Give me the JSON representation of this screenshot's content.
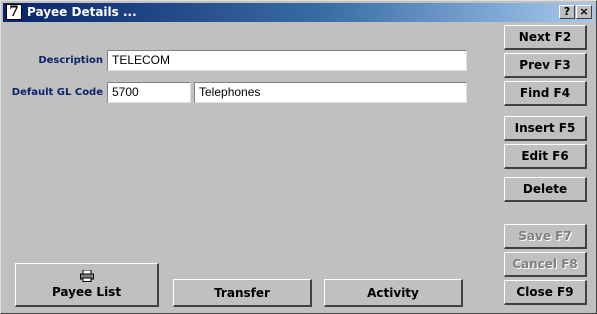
{
  "window": {
    "icon_glyph": "7",
    "title": "Payee Details ...",
    "help_label": "?",
    "close_label": "×"
  },
  "form": {
    "description_label": "Description",
    "description_value": "TELECOM",
    "gl_code_label": "Default GL Code",
    "gl_code_value": "5700",
    "gl_code_name": "Telephones"
  },
  "side_buttons": {
    "next": "Next F2",
    "prev": "Prev F3",
    "find": "Find F4",
    "insert": "Insert F5",
    "edit": "Edit F6",
    "delete": "Delete",
    "save": "Save F7",
    "cancel": "Cancel F8",
    "close": "Close F9"
  },
  "bottom_buttons": {
    "payee_list": "Payee List",
    "payee_list_icon": "printer-icon",
    "transfer": "Transfer",
    "activity": "Activity"
  }
}
